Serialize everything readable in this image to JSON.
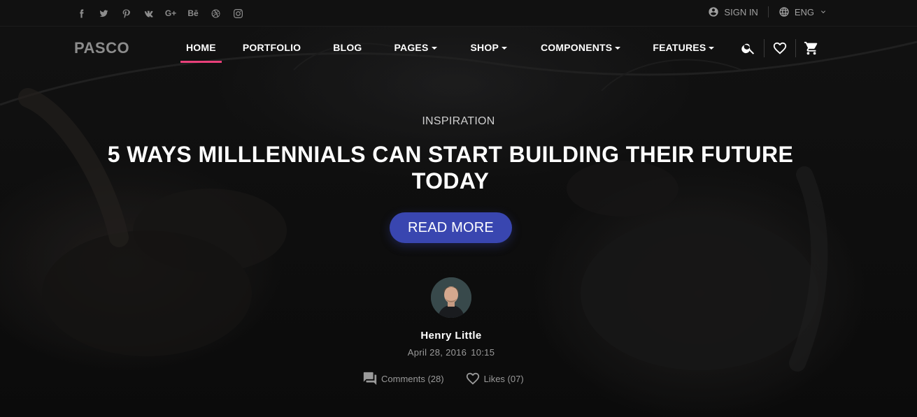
{
  "topbar": {
    "social_icons": [
      "facebook-icon",
      "twitter-icon",
      "pinterest-icon",
      "vk-icon",
      "google-plus-icon",
      "behance-icon",
      "dribbble-icon",
      "instagram-icon"
    ],
    "social_glyphs": {
      "google_plus": "G+",
      "behance": "Bē"
    },
    "sign_in": "SIGN IN",
    "language": "ENG"
  },
  "nav": {
    "logo": "PASCO",
    "items": [
      {
        "label": "HOME",
        "active": true,
        "dropdown": false
      },
      {
        "label": "PORTFOLIO",
        "active": false,
        "dropdown": false
      },
      {
        "label": "BLOG",
        "active": false,
        "dropdown": false
      },
      {
        "label": "PAGES",
        "active": false,
        "dropdown": true
      },
      {
        "label": "SHOP",
        "active": false,
        "dropdown": true
      },
      {
        "label": "COMPONENTS",
        "active": false,
        "dropdown": true
      },
      {
        "label": "FEATURES",
        "active": false,
        "dropdown": true
      }
    ],
    "icons": [
      "search-icon",
      "heart-icon",
      "cart-icon"
    ],
    "active_color": "#e9407a"
  },
  "hero": {
    "category": "INSPIRATION",
    "headline_line1": "5 WAYS MILLLENNIALS CAN START BUILDING THEIR FUTURE",
    "headline_line2": "TODAY",
    "cta": "READ MORE",
    "cta_color": "#3946b0"
  },
  "post": {
    "author": "Henry Little",
    "date": "April 28, 2016",
    "time": "10:15",
    "comments": "Comments (28)",
    "likes": "Likes (07)"
  }
}
